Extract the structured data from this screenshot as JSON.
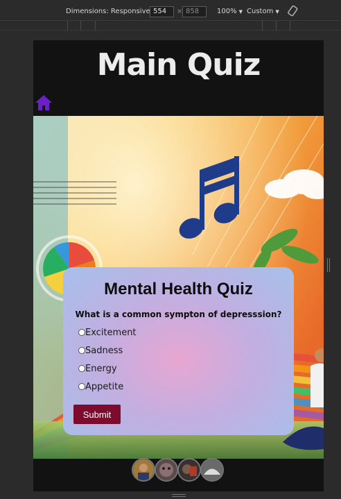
{
  "devtools": {
    "dimensions_label": "Dimensions: Responsive",
    "width": "554",
    "height": "858",
    "zoom": "100%",
    "throttle": "Custom"
  },
  "page": {
    "title": "Main Quiz"
  },
  "quiz": {
    "title": "Mental Health Quiz",
    "question": "What is a common sympton of depresssion?",
    "options": [
      "Excitement",
      "Sadness",
      "Energy",
      "Appetite"
    ],
    "submit_label": "Submit"
  },
  "colors": {
    "page_bg": "#121212",
    "accent_home": "#6a1fc8",
    "submit_bg": "#7c0b2d"
  },
  "icons": {
    "home": "home-icon",
    "rotate": "rotate-icon"
  }
}
